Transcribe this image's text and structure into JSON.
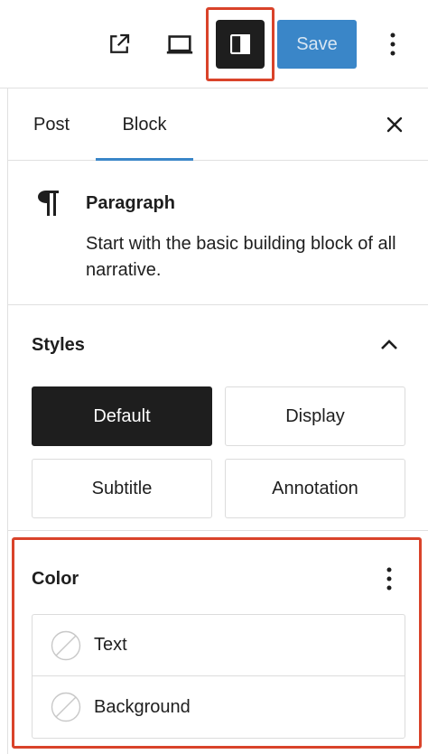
{
  "toolbar": {
    "view_icon": "external-link-icon",
    "preview_icon": "laptop-icon",
    "settings_icon": "sidebar-toggle-icon",
    "save_label": "Save",
    "more_icon": "vertical-ellipsis-icon"
  },
  "sidebar": {
    "tabs": [
      {
        "label": "Post"
      },
      {
        "label": "Block"
      }
    ],
    "active_tab": "Block",
    "close_icon": "close-icon",
    "block": {
      "icon": "paragraph-icon",
      "title": "Paragraph",
      "description": "Start with the basic building block of all narrative."
    },
    "styles": {
      "title": "Styles",
      "toggle_icon": "chevron-up-icon",
      "options": [
        {
          "label": "Default"
        },
        {
          "label": "Display"
        },
        {
          "label": "Subtitle"
        },
        {
          "label": "Annotation"
        }
      ],
      "selected": "Default"
    },
    "color": {
      "title": "Color",
      "more_icon": "vertical-ellipsis-icon",
      "items": [
        {
          "label": "Text",
          "swatch_icon": "no-color-swatch-icon"
        },
        {
          "label": "Background",
          "swatch_icon": "no-color-swatch-icon"
        }
      ]
    }
  },
  "colors": {
    "accent": "#3a86c8",
    "highlight": "#d9432a",
    "dark": "#1e1e1e",
    "border": "#e0e0e0"
  }
}
